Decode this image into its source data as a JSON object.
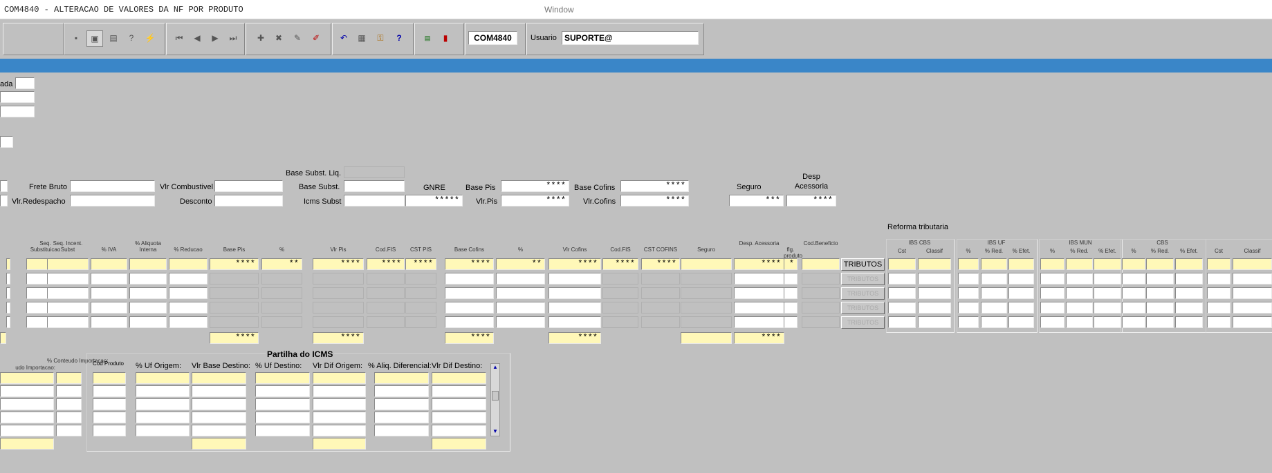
{
  "window": {
    "title": "COM4840 - ALTERACAO DE VALORES DA NF POR PRODUTO",
    "menu_label": "Window"
  },
  "toolbar": {
    "form_code": "COM4840",
    "user_label": "Usuario",
    "user_value": "SUPORTE@",
    "icons": [
      "save-icon",
      "screen-icon",
      "print-icon",
      "query-help-icon",
      "execute-query-icon",
      "first-record-icon",
      "previous-record-icon",
      "next-record-icon",
      "last-record-icon",
      "insert-record-icon",
      "delete-record-icon",
      "edit-record-icon",
      "clear-record-icon",
      "undo-icon",
      "list-icon",
      "key-icon",
      "help-icon",
      "menu-icon",
      "exit-icon"
    ]
  },
  "header_fields": {
    "partial_label": "ada"
  },
  "totals": {
    "frete_bruto": "Frete Bruto",
    "vlr_redespacho": "Vlr.Redespacho",
    "vlr_combustivel": "Vlr Combustivel",
    "desconto": "Desconto",
    "base_subst_liq": "Base Subst. Liq.",
    "base_subst": "Base Subst.",
    "icms_subst": "Icms Subst",
    "gnre": "GNRE",
    "gnre_value": "*****",
    "base_pis": "Base  Pis",
    "base_pis_value": "****",
    "vlr_pis": "Vlr.Pis",
    "vlr_pis_value": "****",
    "base_cofins": "Base  Cofins",
    "base_cofins_value": "****",
    "vlr_cofins": "Vlr.Cofins",
    "vlr_cofins_value": "****",
    "seguro": "Seguro",
    "seguro_value": "***",
    "desp_acessoria": "Desp Acessoria",
    "desp_acessoria_value": "****"
  },
  "grid": {
    "columns": [
      "Seq. Substituicao",
      "Seq. Incent. Subst",
      "% IVA",
      "% Aliquota Interna",
      "% Reducao",
      "Base Pis",
      "%",
      "Vlr Pis",
      "Cod.FIS",
      "CST PIS",
      "Base Cofins",
      "%",
      "Vlr Cofins",
      "Cod.FIS",
      "CST COFINS",
      "Seguro",
      "Desp. Acessoria",
      "flg. produto",
      "Cod.Beneficio"
    ],
    "first_row": [
      "",
      "",
      "",
      "",
      "",
      "****",
      "**",
      "****",
      "****",
      "****",
      "****",
      "**",
      "****",
      "****",
      "****",
      "",
      "****",
      "*",
      ""
    ],
    "tributos_label": "TRIBUTOS",
    "totals_row": {
      "base_pis": "****",
      "vlr_pis": "****",
      "base_cofins": "****",
      "vlr_cofins": "****",
      "seguro": "",
      "desp": "****"
    }
  },
  "reforma": {
    "title": "Reforma tributaria",
    "groups": [
      "IBS CBS",
      "IBS UF",
      "IBS MUN",
      "CBS"
    ],
    "columns": [
      "Cst",
      "Classif",
      "%",
      "% Red.",
      "% Efet.",
      "%",
      "% Red.",
      "% Efet.",
      "%",
      "% Red.",
      "% Efet.",
      "Cst",
      "Classif"
    ]
  },
  "importacao": {
    "col1": "udo Importacao:",
    "col2": "% Conteudo Importacao:"
  },
  "partilha": {
    "title": "Partilha do ICMS",
    "columns": [
      "Cod Produto",
      "% Uf Origem:",
      "Vlr Base Destino:",
      "% Uf Destino:",
      "Vlr Dif Origem:",
      "% Aliq. Diferencial:",
      "Vlr Dif Destino:"
    ]
  },
  "colors": {
    "stripe": "#3a86c8",
    "yellow_field": "#fff8b8",
    "background": "#c0c0c0"
  }
}
